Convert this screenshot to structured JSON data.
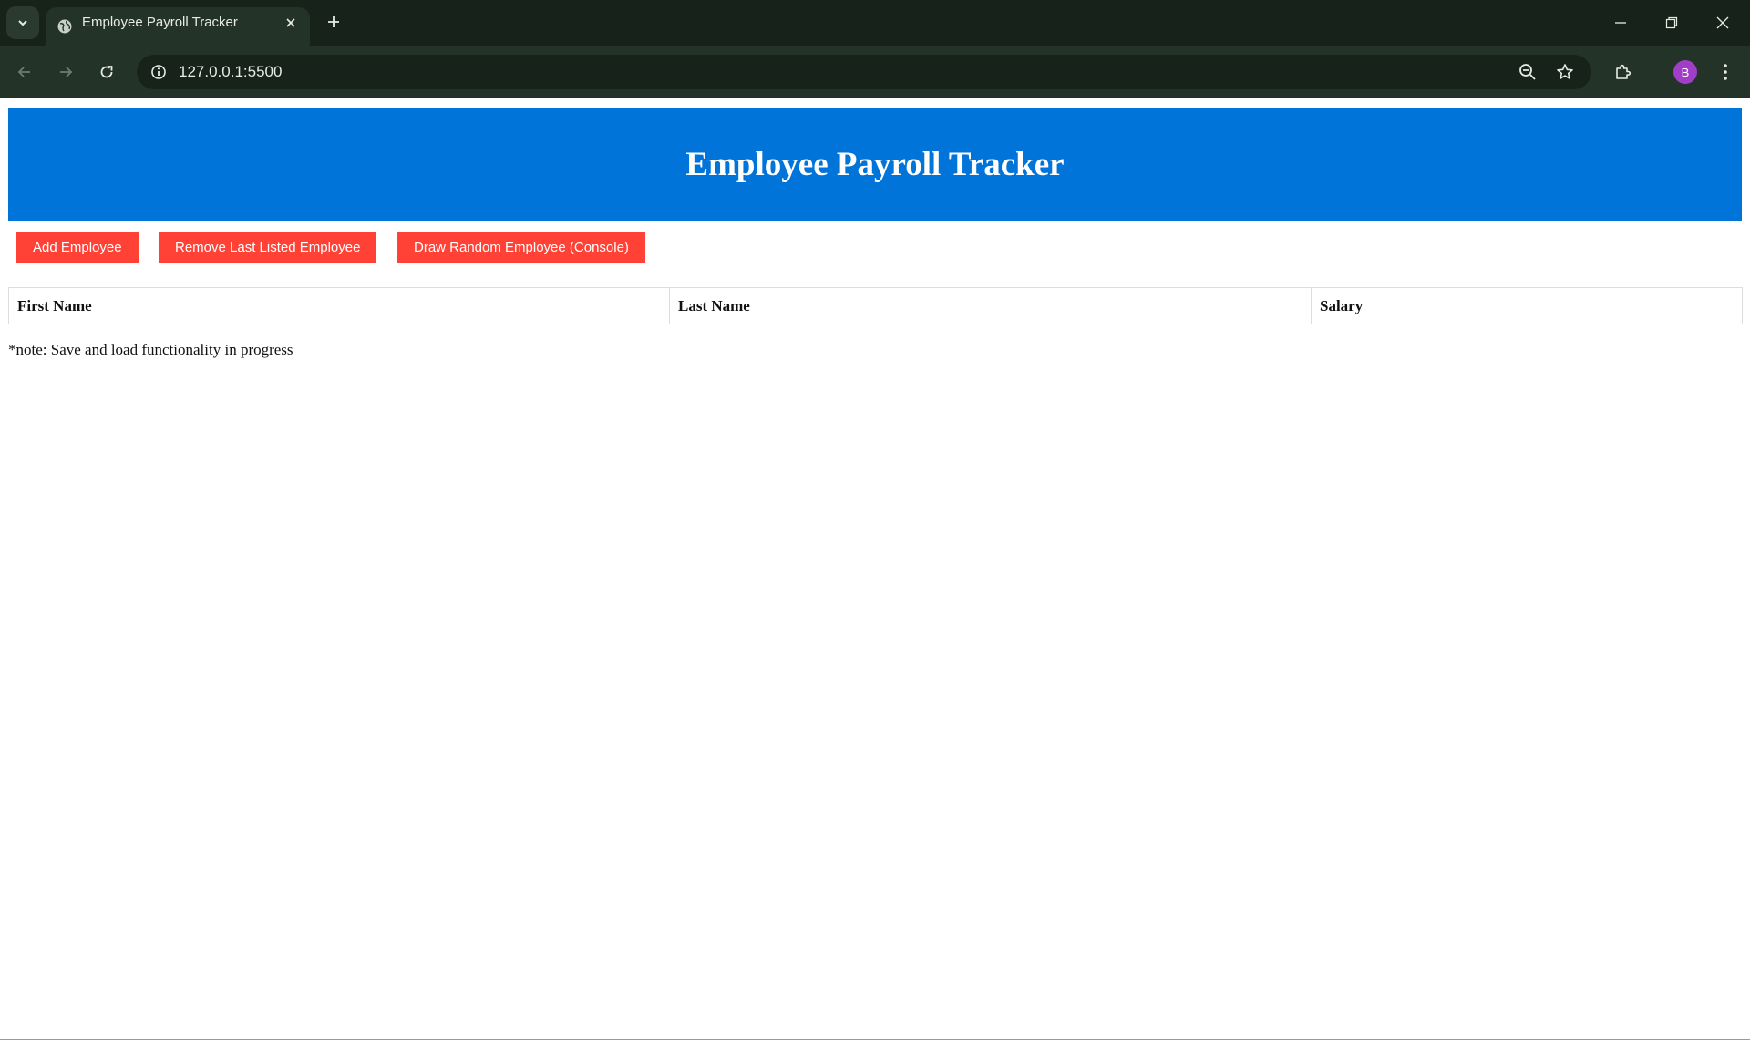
{
  "browser": {
    "tab": {
      "title": "Employee Payroll Tracker",
      "icon": "globe-icon"
    },
    "address": {
      "url": "127.0.0.1:5500"
    },
    "profile_initial": "B",
    "colors": {
      "frame": "#17231a",
      "toolbar": "#243327",
      "avatar": "#a13ec7"
    }
  },
  "page": {
    "header_title": "Employee Payroll Tracker",
    "buttons": {
      "add": "Add Employee",
      "remove": "Remove Last Listed Employee",
      "draw": "Draw Random Employee (Console)"
    },
    "table": {
      "columns": [
        "First Name",
        "Last Name",
        "Salary"
      ],
      "rows": []
    },
    "note": "*note: Save and load functionality in progress",
    "colors": {
      "header": "#0074d9",
      "button": "#ff4136"
    }
  }
}
